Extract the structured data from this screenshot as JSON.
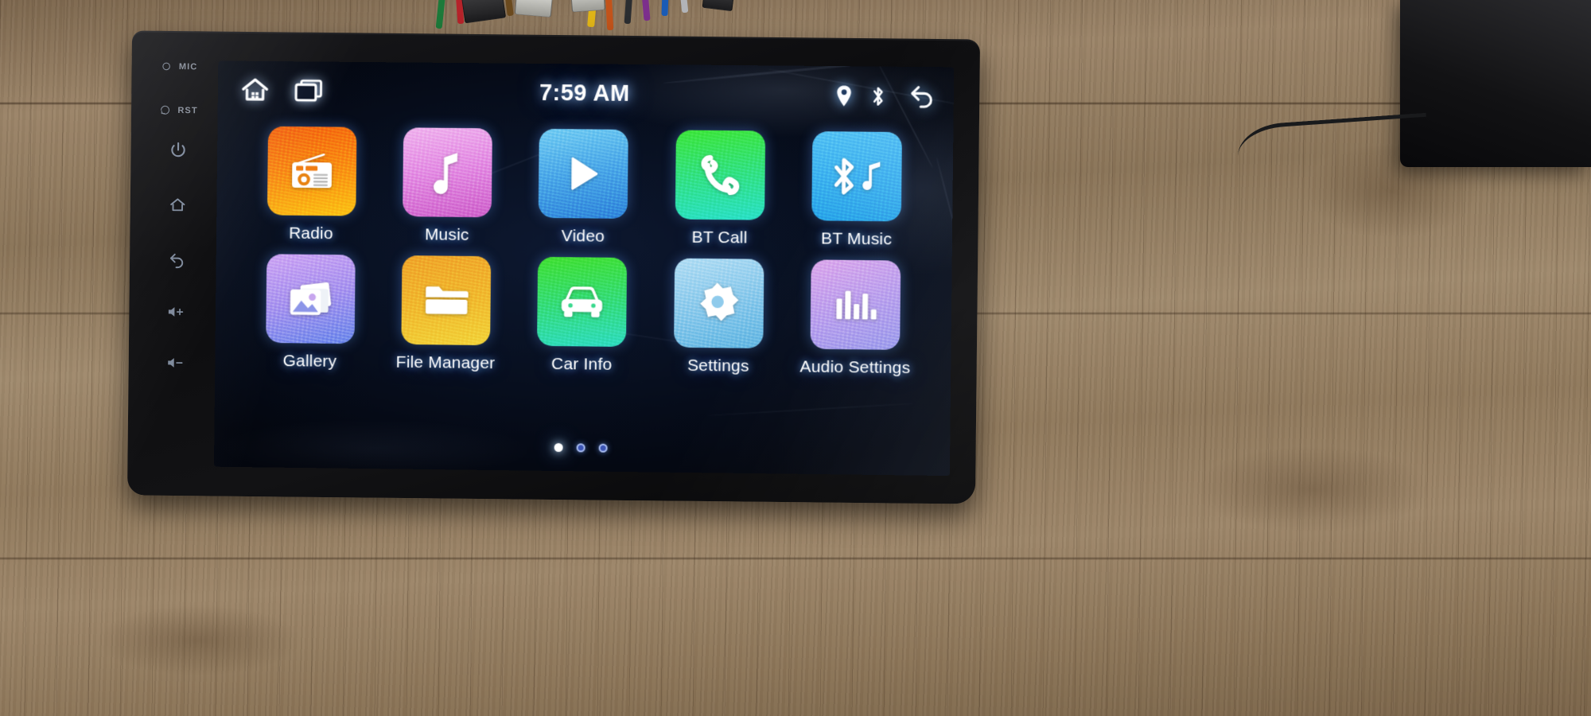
{
  "device": {
    "type": "car-head-unit",
    "bezel_buttons": [
      {
        "name": "mic",
        "label": "MIC",
        "icon": "mic-indicator-icon"
      },
      {
        "name": "reset",
        "label": "RST",
        "icon": "reset-icon"
      },
      {
        "name": "power",
        "label": "",
        "icon": "power-icon"
      },
      {
        "name": "home",
        "label": "",
        "icon": "home-icon"
      },
      {
        "name": "back",
        "label": "",
        "icon": "back-arrow-icon"
      },
      {
        "name": "volume-up",
        "label": "",
        "icon": "volume-up-icon"
      },
      {
        "name": "volume-down",
        "label": "",
        "icon": "volume-down-icon"
      }
    ]
  },
  "status_bar": {
    "clock": "7:59 AM",
    "left_icons": [
      {
        "name": "home-icon",
        "label": "Home"
      },
      {
        "name": "recent-apps-icon",
        "label": "Recent Apps"
      }
    ],
    "right_icons": [
      {
        "name": "location-pin-icon",
        "label": "GPS"
      },
      {
        "name": "bluetooth-icon",
        "label": "Bluetooth"
      },
      {
        "name": "back-arrow-icon",
        "label": "Back"
      }
    ]
  },
  "home_screen": {
    "apps": [
      {
        "label": "Radio",
        "icon": "radio-icon",
        "color_start": "#f4640f",
        "color_end": "#fcc415"
      },
      {
        "label": "Music",
        "icon": "music-note-icon",
        "color_start": "#e9a6e8",
        "color_end": "#d46fd0"
      },
      {
        "label": "Video",
        "icon": "play-icon",
        "color_start": "#5fc4ef",
        "color_end": "#2f86db"
      },
      {
        "label": "BT Call",
        "icon": "phone-handset-icon",
        "color_start": "#37e23c",
        "color_end": "#2ae0c8"
      },
      {
        "label": "BT Music",
        "icon": "bluetooth-music-icon",
        "color_start": "#45b8f0",
        "color_end": "#27a9ea"
      },
      {
        "label": "Gallery",
        "icon": "photos-icon",
        "color_start": "#c6a0f2",
        "color_end": "#6d8bec"
      },
      {
        "label": "File Manager",
        "icon": "folder-icon",
        "color_start": "#f0a52a",
        "color_end": "#f2d23a"
      },
      {
        "label": "Car Info",
        "icon": "car-icon",
        "color_start": "#3ddd2f",
        "color_end": "#2fdcc2"
      },
      {
        "label": "Settings",
        "icon": "gear-icon",
        "color_start": "#9fd4ef",
        "color_end": "#6fc0e6"
      },
      {
        "label": "Audio Settings",
        "icon": "equalizer-icon",
        "color_start": "#cfa4e8",
        "color_end": "#a79bec"
      }
    ],
    "pager": {
      "total": 3,
      "active_index": 0
    }
  }
}
